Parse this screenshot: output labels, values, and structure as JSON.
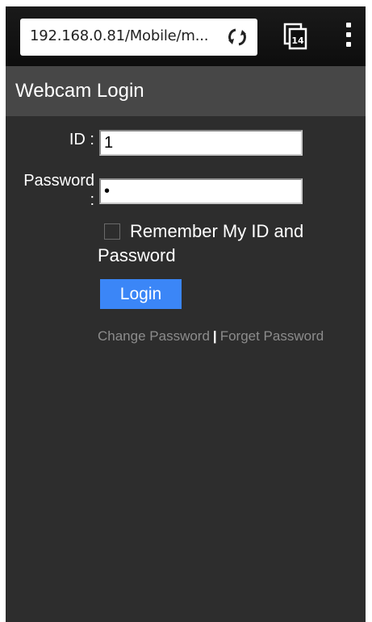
{
  "browser": {
    "url": "192.168.0.81/Mobile/m...",
    "tab_count": "14"
  },
  "header": {
    "title": "Webcam Login"
  },
  "form": {
    "id_label": "ID :",
    "password_label": "Password",
    "password_colon": ":",
    "id_value": "1",
    "password_value": "•",
    "remember_label": "Remember My ID and Password",
    "remember_checked": false,
    "login_label": "Login"
  },
  "links": {
    "change_password": "Change Password",
    "separator": "|",
    "forget_password": "Forget Password"
  },
  "colors": {
    "page_bg": "#2d2d2d",
    "header_bg": "#474747",
    "button_bg": "#3b86f7",
    "link_color": "#8c8c8c"
  },
  "icons": [
    "refresh-icon",
    "tabs-icon",
    "overflow-menu-icon"
  ]
}
